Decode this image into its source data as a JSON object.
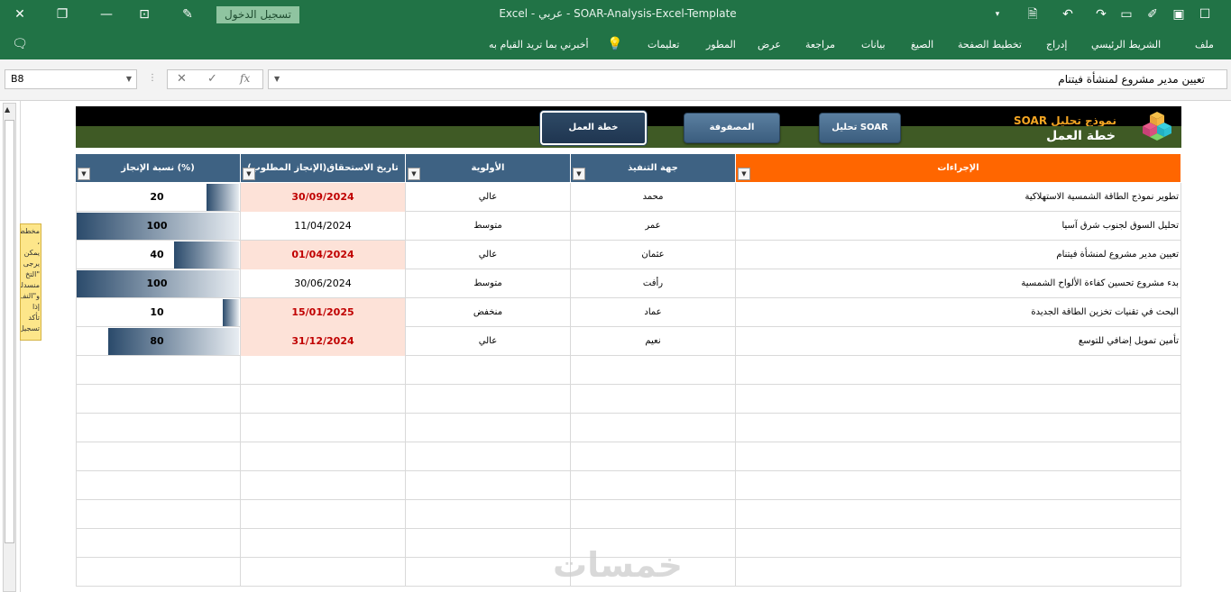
{
  "titlebar": {
    "title": "Excel  -  عربي  - SOAR-Analysis-Excel-Template",
    "login_label": "تسجيل الدخول"
  },
  "ribbon": {
    "tabs": [
      "ملف",
      "الشريط الرئيسي",
      "إدراج",
      "تخطيط الصفحة",
      "الصيغ",
      "بيانات",
      "مراجعة",
      "عرض",
      "المطور",
      "تعليمات"
    ],
    "tell_me": "أخبرني بما تريد القيام به"
  },
  "formula_bar": {
    "name_box": "B8",
    "fx": "fx",
    "content": "تعيين مدير مشروع لمنشأة فيتنام"
  },
  "sheet": {
    "app_title": "نموذج تحليل SOAR",
    "plan_title": "خطة العمل",
    "nav": {
      "soar": "تحليل SOAR",
      "matrix": "المصفوفة",
      "plan": "خطة العمل"
    },
    "sticky_note": "مخطط ، يمكن يرجى \"التخ منسدلة و\"النف إذا تأكد تسجيل",
    "columns": {
      "actions": "الإجراءات",
      "owner": "جهة التنفيذ",
      "priority": "الأولوية",
      "due": "تاريخ الاستحقاق(الإنجاز المطلوب)",
      "pct": "نسبة الإنجاز (%)"
    },
    "rows": [
      {
        "action": "تطوير نموذج الطاقة الشمسية الاستهلاكية",
        "owner": "محمد",
        "priority": "عالي",
        "due": "30/09/2024",
        "due_overdue": true,
        "pct": 20
      },
      {
        "action": "تحليل السوق لجنوب شرق آسيا",
        "owner": "عمر",
        "priority": "متوسط",
        "due": "11/04/2024",
        "due_overdue": false,
        "pct": 100
      },
      {
        "action": "تعيين مدير مشروع لمنشأة فيتنام",
        "owner": "عثمان",
        "priority": "عالي",
        "due": "01/04/2024",
        "due_overdue": true,
        "pct": 40
      },
      {
        "action": "بدء مشروع تحسين كفاءة الألواح الشمسية",
        "owner": "رأفت",
        "priority": "متوسط",
        "due": "30/06/2024",
        "due_overdue": false,
        "pct": 100
      },
      {
        "action": "البحث في تقنيات تخزين الطاقة الجديدة",
        "owner": "عماد",
        "priority": "منخفض",
        "due": "15/01/2025",
        "due_overdue": true,
        "pct": 10
      },
      {
        "action": "تأمين تمويل إضافي للتوسع",
        "owner": "نعيم",
        "priority": "عالي",
        "due": "31/12/2024",
        "due_overdue": true,
        "pct": 80
      }
    ],
    "watermark": "خمسات"
  },
  "colors": {
    "excel_green": "#217346",
    "header_blue": "#3e6283",
    "actions_orange": "#ff6600",
    "overdue_red": "#c00000",
    "overdue_fill": "#fde2d8"
  }
}
